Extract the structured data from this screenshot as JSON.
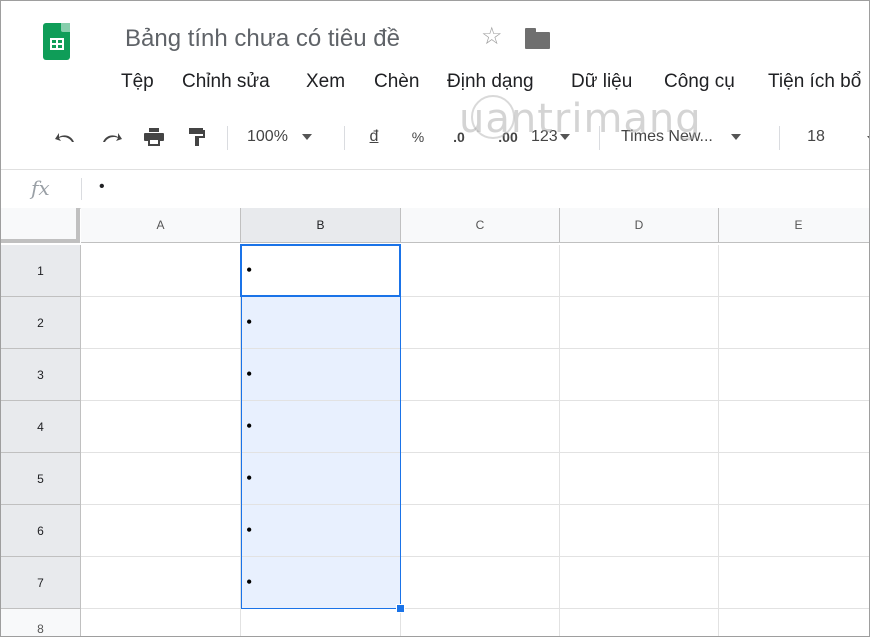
{
  "header": {
    "title": "Bảng tính chưa có tiêu đề",
    "star_icon": "☆"
  },
  "menu": [
    {
      "label": "Tệp"
    },
    {
      "label": "Chỉnh sửa"
    },
    {
      "label": "Xem"
    },
    {
      "label": "Chèn"
    },
    {
      "label": "Định dạng"
    },
    {
      "label": "Dữ liệu"
    },
    {
      "label": "Công cụ"
    },
    {
      "label": "Tiện ích bổ"
    }
  ],
  "toolbar": {
    "zoom": "100%",
    "currency": "đ",
    "percent": "%",
    "decrease_decimal": ".0",
    "increase_decimal": ".00",
    "more_formats": "123",
    "font": "Times New...",
    "font_size": "18"
  },
  "formula_bar": {
    "fx": "fx",
    "value": "•"
  },
  "grid": {
    "columns": [
      "A",
      "B",
      "C",
      "D",
      "E"
    ],
    "rows": [
      "1",
      "2",
      "3",
      "4",
      "5",
      "6",
      "7",
      "8"
    ],
    "column_b_values": [
      "•",
      "•",
      "•",
      "•",
      "•",
      "•",
      "•",
      ""
    ]
  },
  "watermark": "uantrimang",
  "colors": {
    "accent": "#1a73e8",
    "selection_fill": "#e8f0fe",
    "sheets_green": "#0f9d58"
  }
}
